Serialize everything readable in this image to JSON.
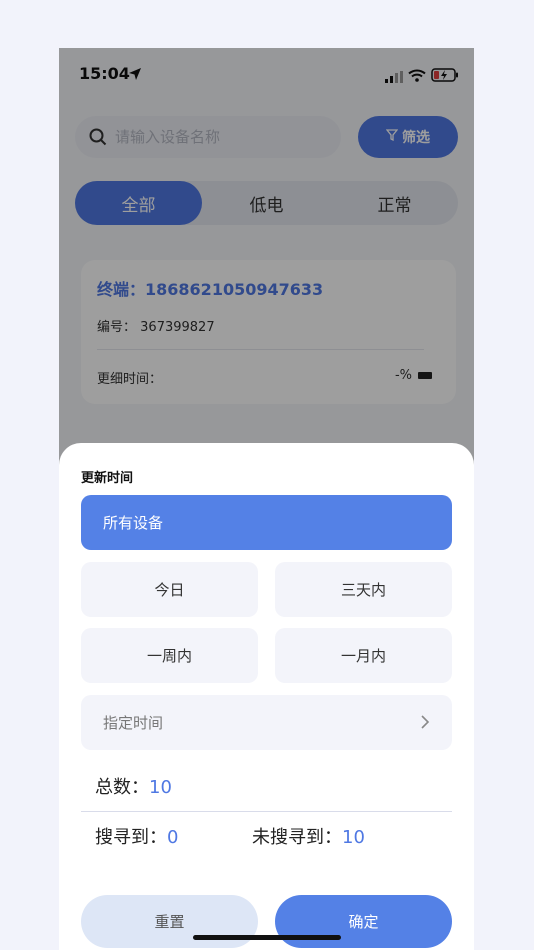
{
  "status_bar": {
    "time": "15:04"
  },
  "search": {
    "placeholder": "请输入设备名称",
    "value": ""
  },
  "filter": {
    "label": "筛选"
  },
  "tabs": [
    {
      "label": "全部",
      "active": true
    },
    {
      "label": "低电",
      "active": false
    },
    {
      "label": "正常",
      "active": false
    }
  ],
  "device_card": {
    "terminal_label": "终端：",
    "terminal_id": "1868621050947633",
    "serial_label": "编号：",
    "serial_value": "367399827",
    "update_label": "更细时间：",
    "battery_value": "-%"
  },
  "sheet": {
    "title": "更新时间",
    "options": {
      "all": "所有设备",
      "today": "今日",
      "three_days": "三天内",
      "week": "一周内",
      "month": "一月内",
      "custom": "指定时间"
    },
    "selected": "所有设备",
    "total_label": "总数：",
    "total_value": "10",
    "found_label": "搜寻到：",
    "found_value": "0",
    "not_found_label": "未搜寻到：",
    "not_found_value": "10",
    "reset_label": "重置",
    "confirm_label": "确定"
  },
  "colors": {
    "accent": "#4f78e3",
    "sheet_active": "#5481e6",
    "reset_bg": "#dde6f6"
  }
}
